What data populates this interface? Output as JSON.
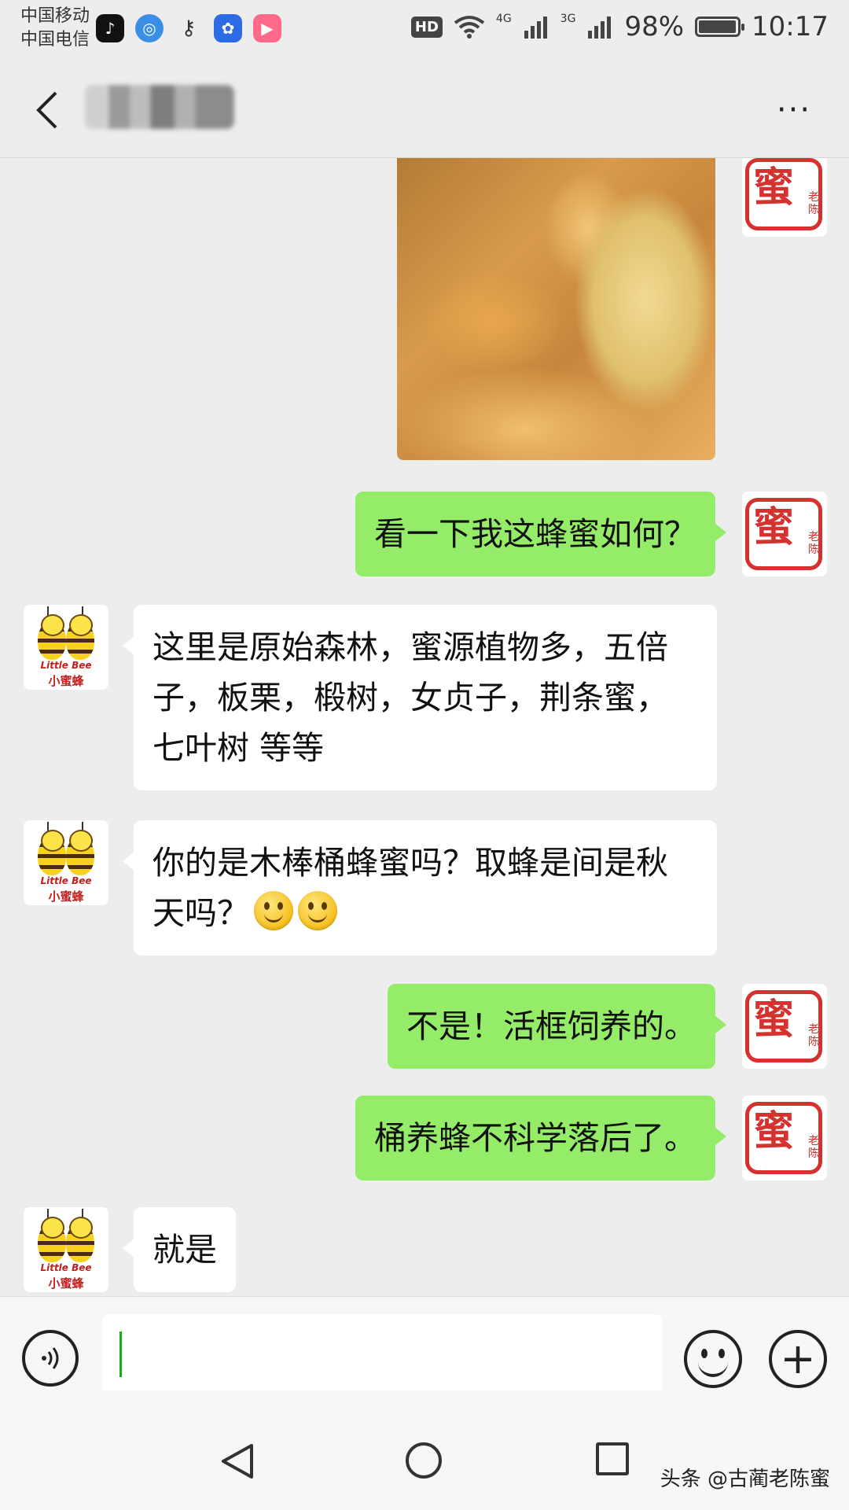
{
  "status_bar": {
    "carrier_1": "中国移动",
    "carrier_2": "中国电信",
    "network_badge": "HD",
    "signal_1": "4G",
    "signal_2": "3G",
    "battery_percent": "98%",
    "battery_level": 0.98,
    "time": "10:17",
    "apps": [
      "douyin-icon",
      "browser-icon",
      "key-icon",
      "baidu-icon",
      "video-icon"
    ]
  },
  "header": {
    "back_icon": "chevron-left-icon",
    "more_label": "···"
  },
  "messages": [
    {
      "side": "mine",
      "type": "image",
      "avatar": "seal"
    },
    {
      "side": "mine",
      "type": "text",
      "text": "看一下我这蜂蜜如何？"
    },
    {
      "side": "theirs",
      "type": "text",
      "text": "这里是原始森林，蜜源植物多，五倍子，板栗，椴树，女贞子，荆条蜜，七叶树 等等"
    },
    {
      "side": "theirs",
      "type": "text",
      "text": "你的是木棒桶蜂蜜吗？取蜂是间是秋天吗？"
    },
    {
      "side": "mine",
      "type": "text",
      "text": "不是！活框饲养的。"
    },
    {
      "side": "mine",
      "type": "text",
      "text": "桶养蜂不科学落后了。"
    },
    {
      "side": "theirs",
      "type": "text",
      "text": "就是"
    }
  ],
  "avatars": {
    "seal_char": "蜜",
    "seal_small": "老陈",
    "bee_text_en": "Little Bee",
    "bee_text_cn": "小蜜蜂"
  },
  "input_bar": {
    "value": "",
    "plus_label": "+"
  },
  "watermark": "头条 @古蔺老陈蜜",
  "colors": {
    "bubble_mine": "#95ec69",
    "bubble_theirs": "#ffffff",
    "background": "#ededed",
    "seal_red": "#d4312f"
  }
}
